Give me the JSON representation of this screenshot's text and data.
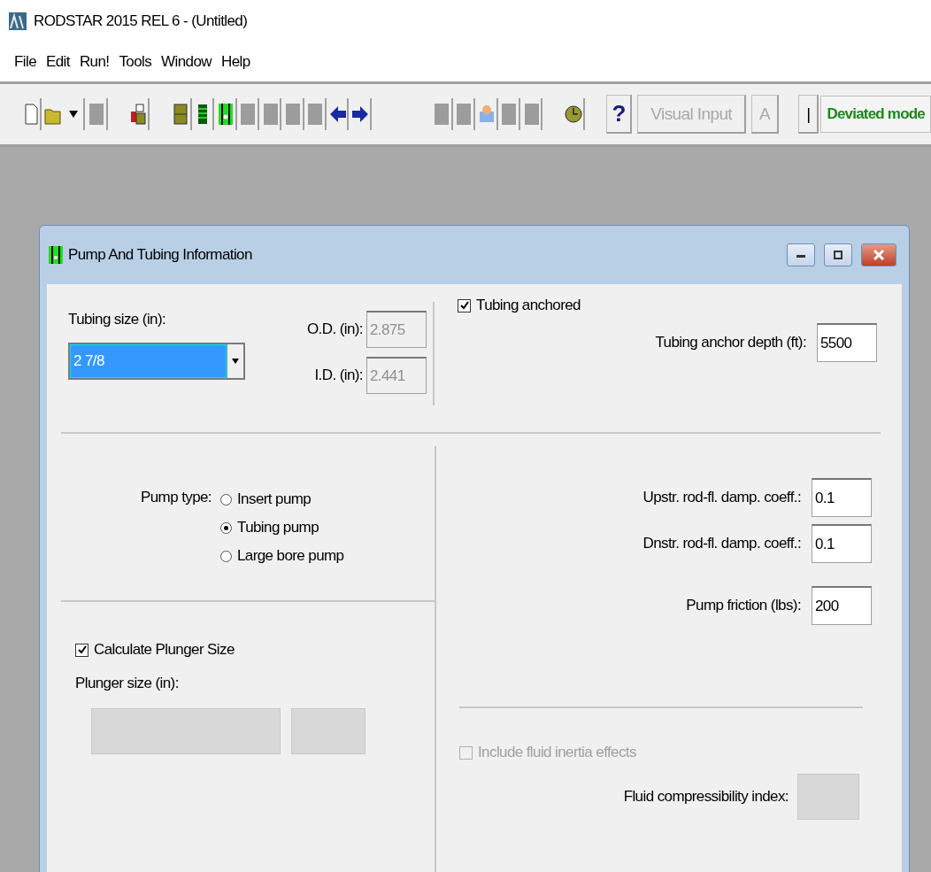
{
  "window": {
    "title": "RODSTAR 2015 REL 6 - (Untitled)"
  },
  "menu": [
    {
      "label": "File"
    },
    {
      "label": "Edit"
    },
    {
      "label": "Run!"
    },
    {
      "label": "Tools"
    },
    {
      "label": "Window"
    },
    {
      "label": "Help"
    }
  ],
  "toolbar": {
    "help": "?",
    "visual_input": {
      "label": "Visual Input",
      "disabled": true
    },
    "a_button": {
      "label": "A",
      "disabled": true
    },
    "bar_button": "|",
    "mode": "Deviated mode"
  },
  "dialog": {
    "title": "Pump And Tubing Information",
    "tubing_size": {
      "label": "Tubing size (in):",
      "value": "2 7/8"
    },
    "od": {
      "label": "O.D. (in):",
      "value": "2.875",
      "disabled": true
    },
    "id": {
      "label": "I.D. (in):",
      "value": "2.441",
      "disabled": true
    },
    "tubing_anchored": {
      "label": "Tubing anchored",
      "checked": true,
      "disabled": false
    },
    "anchor_depth": {
      "label": "Tubing anchor depth (ft):",
      "value": "5500"
    },
    "pump_type": {
      "label": "Pump type:",
      "options": [
        {
          "label": "Insert pump",
          "selected": false
        },
        {
          "label": "Tubing pump",
          "selected": true
        },
        {
          "label": "Large bore pump",
          "selected": false
        }
      ]
    },
    "coefficients": [
      {
        "label": "Upstr. rod-fl. damp. coeff.:",
        "value": "0.1"
      },
      {
        "label": "Dnstr. rod-fl. damp. coeff.:",
        "value": "0.1"
      },
      {
        "label": "Pump friction (lbs):",
        "value": "200"
      }
    ],
    "calculate_plunger": {
      "label": "Calculate Plunger Size",
      "checked": true,
      "disabled": false
    },
    "plunger_size": {
      "label": "Plunger size (in):"
    },
    "fluid_inertia": {
      "label": "Include fluid inertia effects",
      "checked": false,
      "disabled": true
    },
    "compressibility": {
      "label": "Fluid compressibility index:"
    }
  }
}
